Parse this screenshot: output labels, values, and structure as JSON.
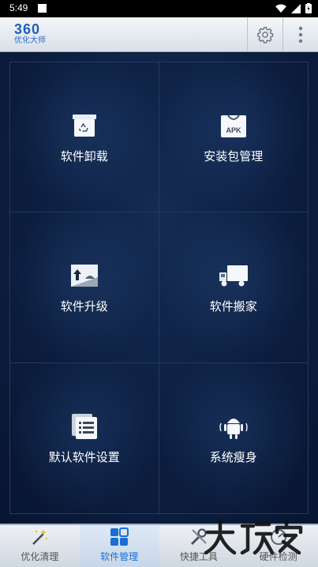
{
  "status": {
    "time": "5:49"
  },
  "app": {
    "logo_number": "360",
    "logo_sub": "优化大师"
  },
  "grid": [
    {
      "label": "软件卸载",
      "icon": "recycle-box-icon"
    },
    {
      "label": "安装包管理",
      "icon": "apk-bag-icon"
    },
    {
      "label": "软件升级",
      "icon": "upgrade-android-icon"
    },
    {
      "label": "软件搬家",
      "icon": "truck-icon"
    },
    {
      "label": "默认软件设置",
      "icon": "list-settings-icon"
    },
    {
      "label": "系统瘦身",
      "icon": "android-shrink-icon"
    }
  ],
  "tabs": [
    {
      "label": "优化清理",
      "icon": "magic-wand-icon",
      "active": false
    },
    {
      "label": "软件管理",
      "icon": "apps-grid-icon",
      "active": true
    },
    {
      "label": "快捷工具",
      "icon": "tools-icon",
      "active": false
    },
    {
      "label": "硬件检测",
      "icon": "hardware-icon",
      "active": false
    }
  ],
  "watermark": "大玩家",
  "colors": {
    "accent": "#1a6fd1",
    "background": "#0d1f42"
  }
}
